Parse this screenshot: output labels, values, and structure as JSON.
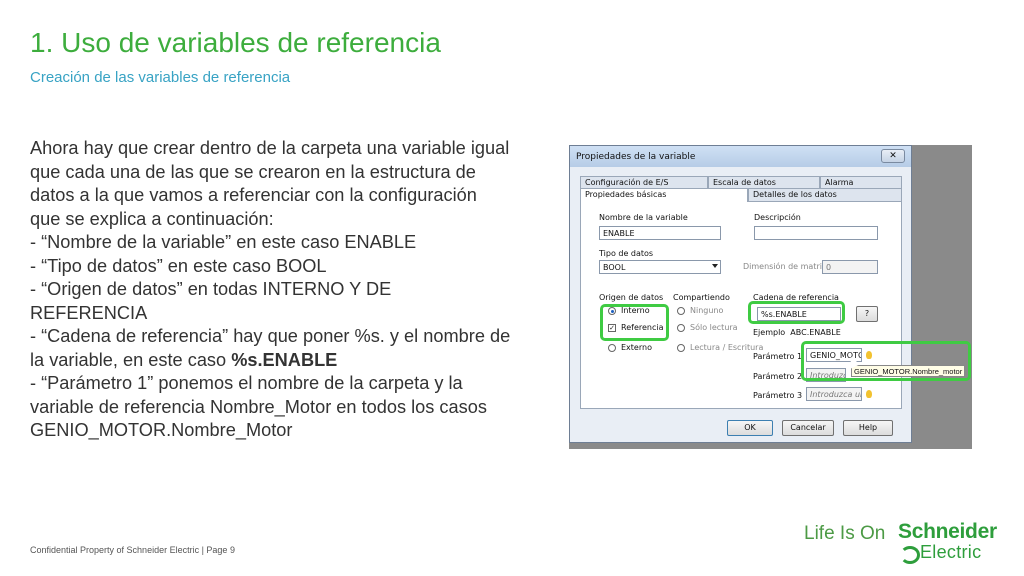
{
  "slide": {
    "title": "1. Uso de variables de referencia",
    "subtitle": "Creación de las variables de referencia",
    "body": {
      "l1": "Ahora hay que crear dentro de la carpeta una variable igual",
      "l2": "que cada una de las que se crearon en la estructura de",
      "l3": "datos a la que vamos a referenciar con la configuración",
      "l4": "que se explica a continuación:",
      "l5": "- “Nombre de la variable” en este caso ENABLE",
      "l6": "- “Tipo de datos” en este caso BOOL",
      "l7": "- “Origen de datos” en todas INTERNO Y DE",
      "l8": "REFERENCIA",
      "l9": "- “Cadena de referencia” hay que poner %s. y el nombre de",
      "l10a": "la variable, en este caso ",
      "l10b": "%s.ENABLE",
      "l11": "- “Parámetro 1” ponemos el nombre de la carpeta y la",
      "l12": "variable de referencia Nombre_Motor en todos los casos",
      "l13": "GENIO_MOTOR.Nombre_Motor"
    },
    "footer": "Confidential Property of Schneider Electric | Page 9",
    "tagline": "Life Is On",
    "logo_top": "Schneider",
    "logo_bottom": "Electric"
  },
  "dialog": {
    "title": "Propiedades de la variable",
    "close": "✕",
    "tabs_row1": [
      "Configuración de E/S",
      "Escala de datos",
      "Alarma"
    ],
    "tabs_row2": [
      "Propiedades básicas",
      "Detalles de los datos"
    ],
    "name_label": "Nombre de la variable",
    "name_value": "ENABLE",
    "desc_label": "Descripción",
    "desc_value": "",
    "type_label": "Tipo de datos",
    "type_value": "BOOL",
    "matrix_label": "Dimensión de matriz",
    "matrix_value": "0",
    "origin_label": "Origen de datos",
    "origin_internal": "Interno",
    "origin_reference": "Referencia",
    "origin_external": "Externo",
    "sharing_label": "Compartiendo",
    "sharing_none": "Ninguno",
    "sharing_read": "Sólo lectura",
    "sharing_rw": "Lectura / Escritura",
    "refchain_label": "Cadena de referencia",
    "refchain_value": "%s.ENABLE",
    "help_small": "?",
    "example_label": "Ejemplo",
    "example_value": "ABC.ENABLE",
    "param1_label": "Parámetro 1",
    "param1_value": "GENIO_MOTOI",
    "param2_label": "Parámetro 2",
    "param2_value": "Introduzca",
    "param3_label": "Parámetro 3",
    "param3_value": "Introduzca una",
    "tooltip": "GENIO_MOTOR.Nombre_motor",
    "ok": "OK",
    "cancel": "Cancelar",
    "help": "Help"
  },
  "colors": {
    "title": "#3dad3d",
    "subtitle": "#38a3c4",
    "highlight": "#3fcb43"
  }
}
